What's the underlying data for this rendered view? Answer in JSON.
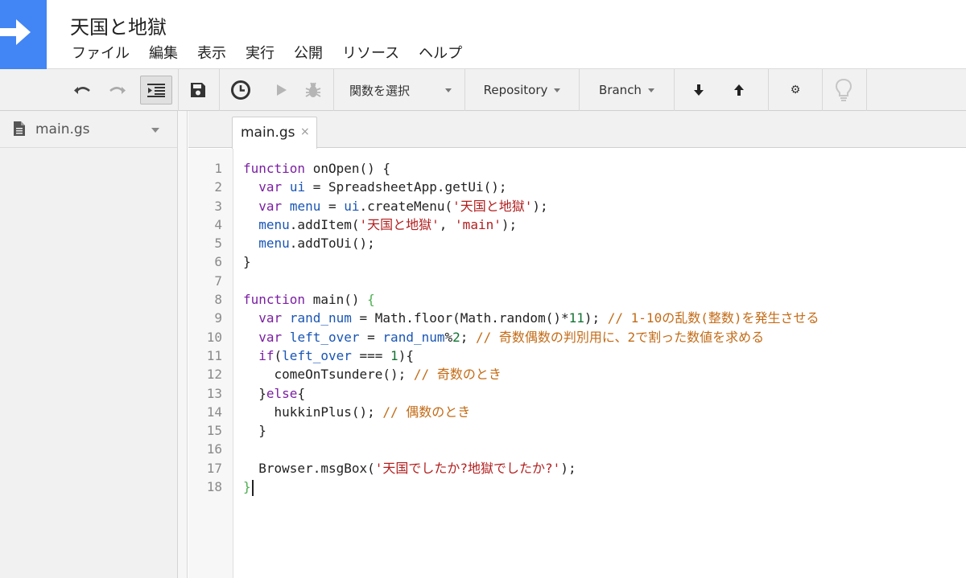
{
  "header": {
    "title": "天国と地獄",
    "logo_icon": "arrow-right-icon",
    "logo_color": "#4285f4",
    "menu": [
      "ファイル",
      "編集",
      "表示",
      "実行",
      "公開",
      "リソース",
      "ヘルプ"
    ]
  },
  "toolbar": {
    "function_select": "関数を選択",
    "repository": "Repository",
    "branch": "Branch",
    "gear_icon": "⚙"
  },
  "sidebar": {
    "file_name": "main.gs"
  },
  "editor": {
    "tab_label": "main.gs",
    "tab_close": "×",
    "line_numbers": [
      "1",
      "2",
      "3",
      "4",
      "5",
      "6",
      "7",
      "8",
      "9",
      "10",
      "11",
      "12",
      "13",
      "14",
      "15",
      "16",
      "17",
      "18"
    ],
    "code": [
      [
        [
          "kw",
          "function"
        ],
        [
          "t",
          " onOpen() {"
        ]
      ],
      [
        [
          "t",
          "  "
        ],
        [
          "kw",
          "var"
        ],
        [
          "t",
          " "
        ],
        [
          "var",
          "ui"
        ],
        [
          "t",
          " = SpreadsheetApp.getUi();"
        ]
      ],
      [
        [
          "t",
          "  "
        ],
        [
          "kw",
          "var"
        ],
        [
          "t",
          " "
        ],
        [
          "var",
          "menu"
        ],
        [
          "t",
          " = "
        ],
        [
          "var",
          "ui"
        ],
        [
          "t",
          ".createMenu("
        ],
        [
          "str",
          "'天国と地獄'"
        ],
        [
          "t",
          ");"
        ]
      ],
      [
        [
          "t",
          "  "
        ],
        [
          "var",
          "menu"
        ],
        [
          "t",
          ".addItem("
        ],
        [
          "str",
          "'天国と地獄'"
        ],
        [
          "t",
          ", "
        ],
        [
          "str",
          "'main'"
        ],
        [
          "t",
          ");"
        ]
      ],
      [
        [
          "t",
          "  "
        ],
        [
          "var",
          "menu"
        ],
        [
          "t",
          ".addToUi();"
        ]
      ],
      [
        [
          "t",
          "}"
        ]
      ],
      [],
      [
        [
          "kw",
          "function"
        ],
        [
          "t",
          " main() "
        ],
        [
          "brk",
          "{"
        ]
      ],
      [
        [
          "t",
          "  "
        ],
        [
          "kw",
          "var"
        ],
        [
          "t",
          " "
        ],
        [
          "var",
          "rand_num"
        ],
        [
          "t",
          " = Math.floor(Math.random()*"
        ],
        [
          "num",
          "11"
        ],
        [
          "t",
          "); "
        ],
        [
          "cmt",
          "// 1-10の乱数(整数)を発生させる"
        ]
      ],
      [
        [
          "t",
          "  "
        ],
        [
          "kw",
          "var"
        ],
        [
          "t",
          " "
        ],
        [
          "var",
          "left_over"
        ],
        [
          "t",
          " = "
        ],
        [
          "var",
          "rand_num"
        ],
        [
          "t",
          "%"
        ],
        [
          "num",
          "2"
        ],
        [
          "t",
          "; "
        ],
        [
          "cmt",
          "// 奇数偶数の判別用に、2で割った数値を求める"
        ]
      ],
      [
        [
          "t",
          "  "
        ],
        [
          "kw",
          "if"
        ],
        [
          "t",
          "("
        ],
        [
          "var",
          "left_over"
        ],
        [
          "t",
          " === "
        ],
        [
          "num",
          "1"
        ],
        [
          "t",
          "){"
        ]
      ],
      [
        [
          "t",
          "    comeOnTsundere(); "
        ],
        [
          "cmt",
          "// 奇数のとき"
        ]
      ],
      [
        [
          "t",
          "  }"
        ],
        [
          "kw",
          "else"
        ],
        [
          "t",
          "{"
        ]
      ],
      [
        [
          "t",
          "    hukkinPlus(); "
        ],
        [
          "cmt",
          "// 偶数のとき"
        ]
      ],
      [
        [
          "t",
          "  }"
        ]
      ],
      [],
      [
        [
          "t",
          "  Browser.msgBox("
        ],
        [
          "str",
          "'天国でしたか?地獄でしたか?'"
        ],
        [
          "t",
          ");"
        ]
      ],
      [
        [
          "brk",
          "}"
        ],
        [
          "cursor",
          ""
        ]
      ]
    ]
  }
}
